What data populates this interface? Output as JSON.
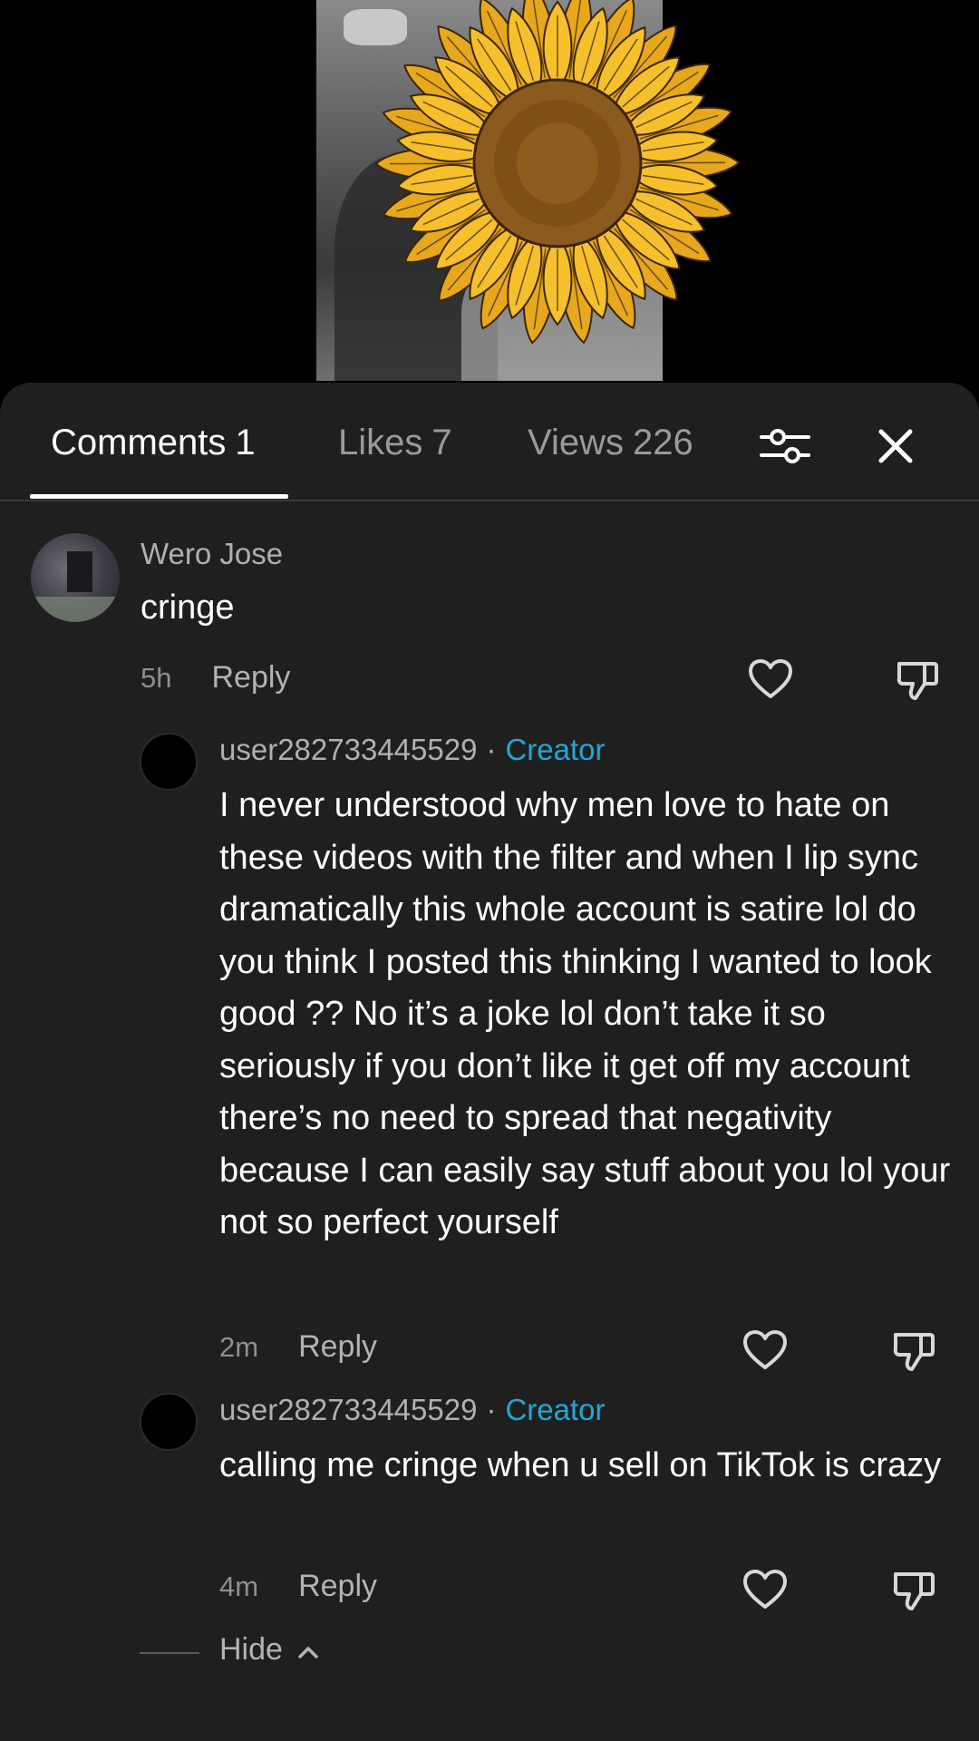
{
  "tabs": [
    {
      "label": "Comments",
      "count": "1",
      "active": true
    },
    {
      "label": "Likes",
      "count": "7",
      "active": false
    },
    {
      "label": "Views",
      "count": "226",
      "active": false
    }
  ],
  "icons": {
    "filter": "filter-sliders-icon",
    "close": "close-icon",
    "like": "heart-icon",
    "dislike": "thumbs-down-icon",
    "hide": "chevron-up-icon"
  },
  "colors": {
    "sheet_background": "#1f1f1f",
    "creator_badge": "#20a8d8"
  },
  "comments": [
    {
      "username": "Wero Jose",
      "text": "cringe",
      "time": "5h",
      "reply_label": "Reply"
    }
  ],
  "replies": [
    {
      "username": "user282733445529",
      "separator": "·",
      "badge": "Creator",
      "text": "I never understood why men love to hate on these videos with the filter and when I lip sync dramatically this whole account is satire lol do you think I posted this thinking I wanted to look good ?? No it’s a joke lol don’t take it so seriously if you don’t like it get off my account there’s no need to spread that negativity because I can easily say stuff about you lol your not so perfect yourself",
      "time": "2m",
      "reply_label": "Reply"
    },
    {
      "username": "user282733445529",
      "separator": "·",
      "badge": "Creator",
      "text": "calling me cringe when u sell on TikTok is crazy",
      "time": "4m",
      "reply_label": "Reply"
    }
  ],
  "hide_label": "Hide"
}
